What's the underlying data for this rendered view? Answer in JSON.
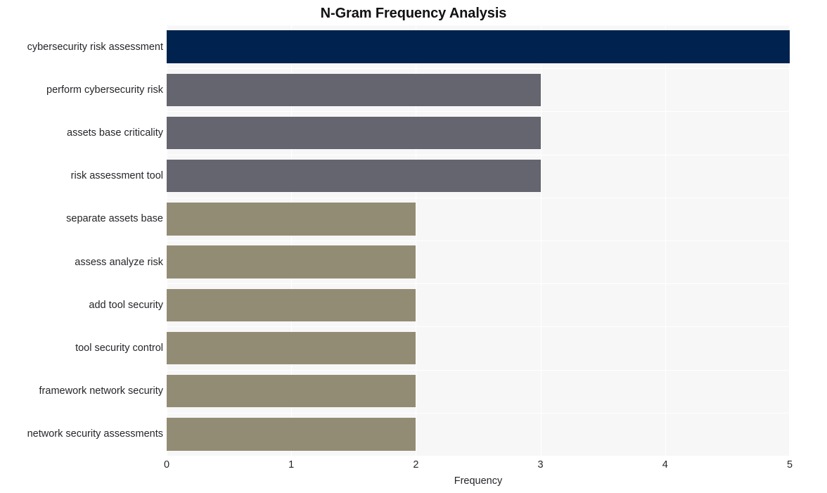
{
  "chart_data": {
    "type": "bar",
    "orientation": "horizontal",
    "title": "N-Gram Frequency Analysis",
    "xlabel": "Frequency",
    "ylabel": "",
    "xlim": [
      0,
      5
    ],
    "xticks": [
      0,
      1,
      2,
      3,
      4,
      5
    ],
    "xtick_labels": [
      "0",
      "1",
      "2",
      "3",
      "4",
      "5"
    ],
    "grid": true,
    "legend": null,
    "categories": [
      "cybersecurity risk assessment",
      "perform cybersecurity risk",
      "assets base criticality",
      "risk assessment tool",
      "separate assets base",
      "assess analyze risk",
      "add tool security",
      "tool security control",
      "framework network security",
      "network security assessments"
    ],
    "values": [
      5,
      3,
      3,
      3,
      2,
      2,
      2,
      2,
      2,
      2
    ],
    "bar_colors": [
      "#00224e",
      "#64656e",
      "#64656e",
      "#64656e",
      "#938c74",
      "#938c74",
      "#938c74",
      "#938c74",
      "#938c74",
      "#938c74"
    ]
  },
  "style": {
    "plot_background": "#f7f7f8",
    "figure_background": "#ffffff",
    "grid_color": "#ffffff",
    "tick_label_color": "#26262b",
    "title_color": "#111111"
  }
}
